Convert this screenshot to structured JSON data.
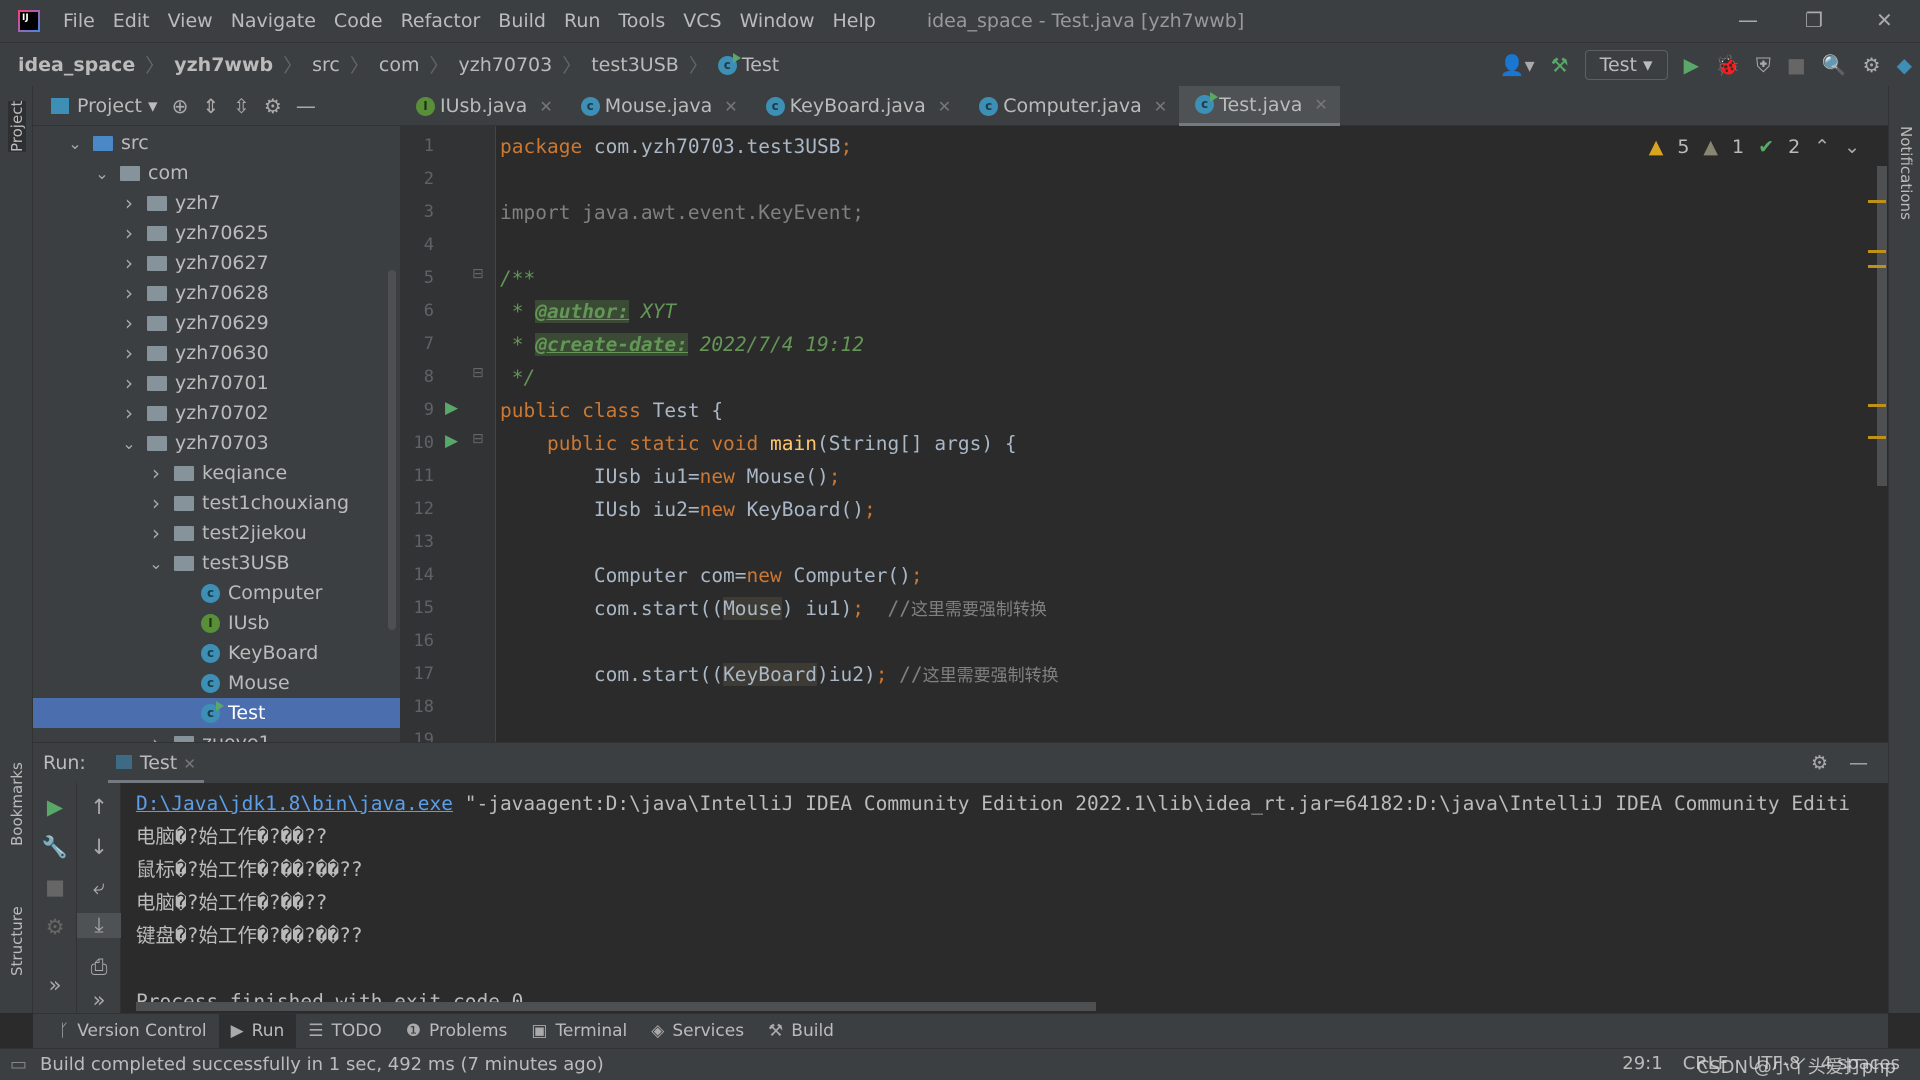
{
  "window": {
    "title": "idea_space - Test.java [yzh7wwb]",
    "logo": "IJ"
  },
  "menu": [
    "File",
    "Edit",
    "View",
    "Navigate",
    "Code",
    "Refactor",
    "Build",
    "Run",
    "Tools",
    "VCS",
    "Window",
    "Help"
  ],
  "breadcrumb": [
    "idea_space",
    "yzh7wwb",
    "src",
    "com",
    "yzh70703",
    "test3USB",
    "Test"
  ],
  "toolbar": {
    "run_config": "Test"
  },
  "project": {
    "title": "Project",
    "tree": [
      {
        "label": "src",
        "depth": 0,
        "kind": "src",
        "open": true
      },
      {
        "label": "com",
        "depth": 1,
        "kind": "folder",
        "open": true
      },
      {
        "label": "yzh7",
        "depth": 2,
        "kind": "folder",
        "open": false
      },
      {
        "label": "yzh70625",
        "depth": 2,
        "kind": "folder",
        "open": false
      },
      {
        "label": "yzh70627",
        "depth": 2,
        "kind": "folder",
        "open": false
      },
      {
        "label": "yzh70628",
        "depth": 2,
        "kind": "folder",
        "open": false
      },
      {
        "label": "yzh70629",
        "depth": 2,
        "kind": "folder",
        "open": false
      },
      {
        "label": "yzh70630",
        "depth": 2,
        "kind": "folder",
        "open": false
      },
      {
        "label": "yzh70701",
        "depth": 2,
        "kind": "folder",
        "open": false
      },
      {
        "label": "yzh70702",
        "depth": 2,
        "kind": "folder",
        "open": false
      },
      {
        "label": "yzh70703",
        "depth": 2,
        "kind": "folder",
        "open": true
      },
      {
        "label": "keqiance",
        "depth": 3,
        "kind": "folder",
        "open": false
      },
      {
        "label": "test1chouxiang",
        "depth": 3,
        "kind": "folder",
        "open": false
      },
      {
        "label": "test2jiekou",
        "depth": 3,
        "kind": "folder",
        "open": false
      },
      {
        "label": "test3USB",
        "depth": 3,
        "kind": "folder",
        "open": true
      },
      {
        "label": "Computer",
        "depth": 4,
        "kind": "class"
      },
      {
        "label": "IUsb",
        "depth": 4,
        "kind": "interface"
      },
      {
        "label": "KeyBoard",
        "depth": 4,
        "kind": "class"
      },
      {
        "label": "Mouse",
        "depth": 4,
        "kind": "class"
      },
      {
        "label": "Test",
        "depth": 4,
        "kind": "class-main",
        "selected": true
      },
      {
        "label": "zuoye1",
        "depth": 3,
        "kind": "folder",
        "open": false
      }
    ]
  },
  "tabs": [
    {
      "label": "IUsb.java",
      "kind": "interface"
    },
    {
      "label": "Mouse.java",
      "kind": "class"
    },
    {
      "label": "KeyBoard.java",
      "kind": "class"
    },
    {
      "label": "Computer.java",
      "kind": "class"
    },
    {
      "label": "Test.java",
      "kind": "class-main",
      "active": true
    }
  ],
  "inspections": {
    "warnings": "5",
    "weak_warnings": "1",
    "typos": "2"
  },
  "code": [
    [
      [
        "kw",
        "package "
      ],
      [
        "pl",
        "com.yzh70703.test3USB"
      ],
      [
        "kw",
        ";"
      ]
    ],
    [],
    [
      [
        "cm",
        "import java.awt.event.KeyEvent;"
      ]
    ],
    [],
    [
      [
        "dc",
        "/**"
      ]
    ],
    [
      [
        "dc",
        " * "
      ],
      [
        "tag",
        "@author:"
      ],
      [
        "dc",
        " XYT"
      ]
    ],
    [
      [
        "dc",
        " * "
      ],
      [
        "tag",
        "@create-date:"
      ],
      [
        "dc",
        " 2022/7/4 19:12"
      ]
    ],
    [
      [
        "dc",
        " */"
      ]
    ],
    [
      [
        "kw",
        "public class "
      ],
      [
        "pl",
        "Test {"
      ]
    ],
    [
      [
        "kw",
        "    public static void "
      ],
      [
        "fn",
        "main"
      ],
      [
        "pl",
        "(String[] args) {"
      ]
    ],
    [
      [
        "pl",
        "        IUsb iu1="
      ],
      [
        "kw",
        "new "
      ],
      [
        "pl",
        "Mouse()"
      ],
      [
        "kw",
        ";"
      ]
    ],
    [
      [
        "pl",
        "        IUsb iu2="
      ],
      [
        "kw",
        "new "
      ],
      [
        "pl",
        "KeyBoard()"
      ],
      [
        "kw",
        ";"
      ]
    ],
    [],
    [
      [
        "pl",
        "        Computer com="
      ],
      [
        "kw",
        "new "
      ],
      [
        "pl",
        "Computer()"
      ],
      [
        "kw",
        ";"
      ]
    ],
    [
      [
        "pl",
        "        com.start(("
      ],
      [
        "cast",
        "Mouse"
      ],
      [
        "pl",
        ") iu1)"
      ],
      [
        "kw",
        ";"
      ],
      [
        "cm",
        "  //"
      ],
      [
        "cmz",
        "这里需要强制转换"
      ]
    ],
    [],
    [
      [
        "pl",
        "        com.start(("
      ],
      [
        "cast",
        "KeyBoard"
      ],
      [
        "pl",
        ")iu2)"
      ],
      [
        "kw",
        ";"
      ],
      [
        "cm",
        " //"
      ],
      [
        "cmz",
        "这里需要强制转换"
      ]
    ],
    [],
    []
  ],
  "run": {
    "label": "Run:",
    "tab": "Test",
    "console": [
      {
        "link": "D:\\Java\\jdk1.8\\bin\\java.exe",
        "text": " \"-javaagent:D:\\java\\IntelliJ IDEA Community Edition 2022.1\\lib\\idea_rt.jar=64182:D:\\java\\IntelliJ IDEA Community Editi"
      },
      {
        "text": "电脑�?始工作�?��??"
      },
      {
        "text": "鼠标�?始工作�?��?��??"
      },
      {
        "text": "电脑�?始工作�?��??"
      },
      {
        "text": "键盘�?始工作�?��?��??"
      },
      {
        "text": ""
      },
      {
        "text": "Process finished with exit code 0"
      }
    ]
  },
  "bottom_tools": [
    {
      "label": "Version Control",
      "icon": "branch-icon"
    },
    {
      "label": "Run",
      "icon": "run-icon",
      "active": true
    },
    {
      "label": "TODO",
      "icon": "list-icon"
    },
    {
      "label": "Problems",
      "icon": "problems-icon"
    },
    {
      "label": "Terminal",
      "icon": "terminal-icon"
    },
    {
      "label": "Services",
      "icon": "services-icon"
    },
    {
      "label": "Build",
      "icon": "hammer-icon"
    }
  ],
  "side": {
    "project": "Project",
    "bookmarks": "Bookmarks",
    "structure": "Structure",
    "notifications": "Notifications"
  },
  "status": {
    "message": "Build completed successfully in 1 sec, 492 ms (7 minutes ago)",
    "position": "29:1",
    "line_sep": "CRLF",
    "encoding": "UTF-8",
    "indent": "4 spaces",
    "watermark": "CSDN @小丫头爱打php"
  },
  "colors": {
    "accent": "#4b6eaf",
    "keyword": "#cc7832",
    "javadoc": "#629755",
    "run_green": "#59a869"
  }
}
